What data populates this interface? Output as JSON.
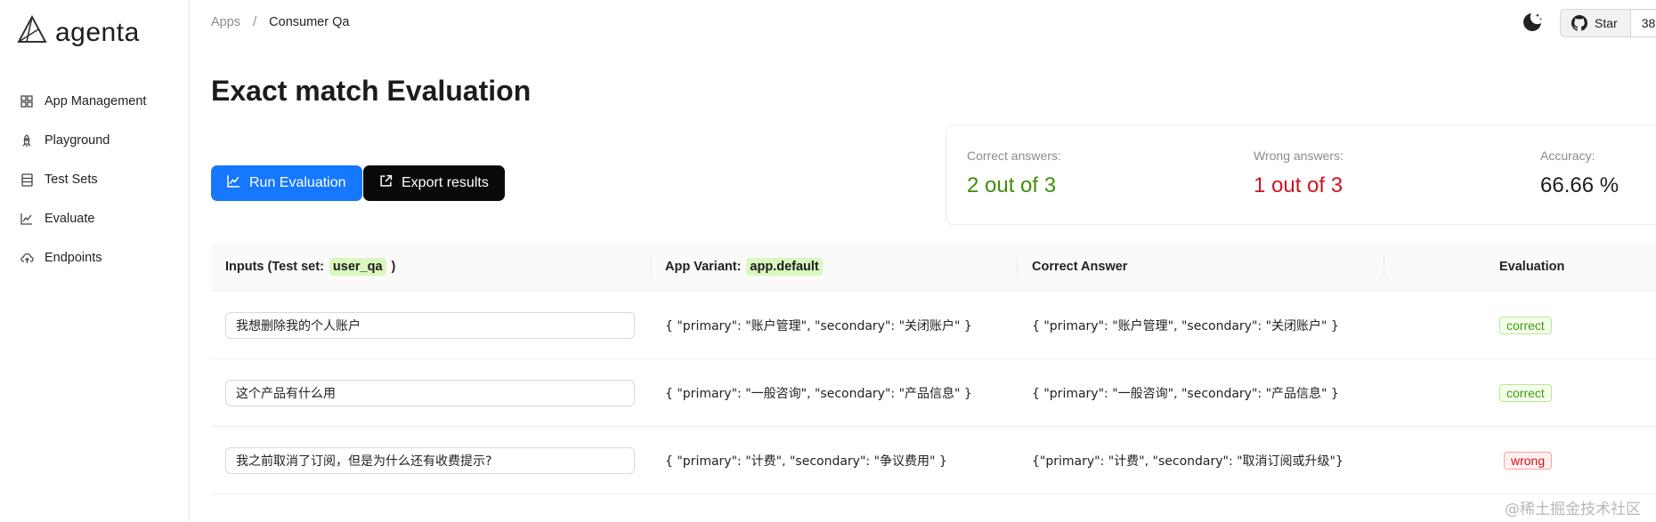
{
  "sidebar": {
    "logo_text": "agenta",
    "items": [
      {
        "label": "App Management",
        "icon": "grid-icon"
      },
      {
        "label": "Playground",
        "icon": "rocket-icon"
      },
      {
        "label": "Test Sets",
        "icon": "database-icon"
      },
      {
        "label": "Evaluate",
        "icon": "line-chart-icon"
      },
      {
        "label": "Endpoints",
        "icon": "cloud-upload-icon"
      }
    ]
  },
  "header": {
    "breadcrumb": {
      "parent": "Apps",
      "separator": "/",
      "current": "Consumer Qa"
    },
    "github": {
      "star_label": "Star",
      "count": "38"
    }
  },
  "main": {
    "title": "Exact match Evaluation",
    "run_button": "Run Evaluation",
    "export_button": "Export results",
    "stats": {
      "correct_label": "Correct answers:",
      "correct_value": "2 out of 3",
      "wrong_label": "Wrong answers:",
      "wrong_value": "1 out of 3",
      "accuracy_label": "Accuracy:",
      "accuracy_value": "66.66 %"
    },
    "table": {
      "columns": {
        "inputs_prefix": "Inputs (Test set:",
        "inputs_testset": "user_qa",
        "inputs_suffix": ")",
        "variant_prefix": "App Variant:",
        "variant_name": "app.default",
        "correct_answer": "Correct Answer",
        "evaluation": "Evaluation"
      },
      "rows": [
        {
          "input": "我想删除我的个人账户",
          "output": "{ \"primary\": \"账户管理\", \"secondary\": \"关闭账户\" }",
          "correct": "{ \"primary\": \"账户管理\", \"secondary\": \"关闭账户\" }",
          "evaluation": "correct"
        },
        {
          "input": "这个产品有什么用",
          "output": "{ \"primary\": \"一般咨询\", \"secondary\": \"产品信息\" }",
          "correct": "{ \"primary\": \"一般咨询\", \"secondary\": \"产品信息\" }",
          "evaluation": "correct"
        },
        {
          "input": "我之前取消了订阅，但是为什么还有收费提示?",
          "output": "{ \"primary\": \"计费\", \"secondary\": \"争议费用\" }",
          "correct": "{\"primary\": \"计费\", \"secondary\": \"取消订阅或升级\"}",
          "evaluation": "wrong"
        }
      ]
    }
  },
  "watermark": "@稀土掘金技术社区",
  "colors": {
    "primary": "#1677ff",
    "correct": "#3f8f0a",
    "wrong": "#cf1322",
    "highlight": "#d9f7be"
  }
}
